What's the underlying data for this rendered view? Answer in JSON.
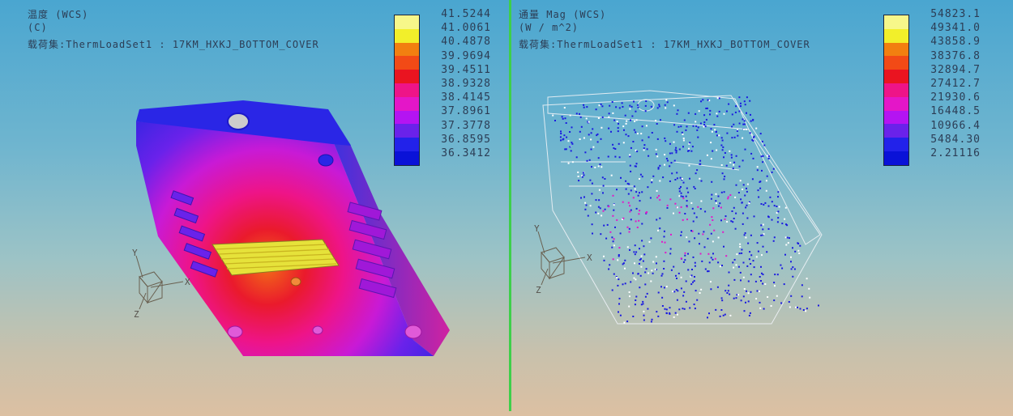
{
  "legend_colors": [
    "#f7f78a",
    "#f2ef2a",
    "#f27f10",
    "#f24a16",
    "#ea1420",
    "#ee1488",
    "#e416c8",
    "#b414f2",
    "#6a22ea",
    "#2222ea",
    "#0a12d8"
  ],
  "left_panel": {
    "header": {
      "line1": "温度 (WCS)",
      "line2": "(C)",
      "line3": "载荷集:ThermLoadSet1 : 17KM_HXKJ_BOTTOM_COVER"
    },
    "legend_values": [
      "41.5244",
      "41.0061",
      "40.4878",
      "39.9694",
      "39.4511",
      "38.9328",
      "38.4145",
      "37.8961",
      "37.3778",
      "36.8595",
      "36.3412"
    ],
    "triad": {
      "x": "X",
      "y": "Y",
      "z": "Z"
    }
  },
  "right_panel": {
    "header": {
      "line1": "通量 Mag (WCS)",
      "line2": "(W / m^2)",
      "line3": "载荷集:ThermLoadSet1 : 17KM_HXKJ_BOTTOM_COVER"
    },
    "legend_values": [
      "54823.1",
      "49341.0",
      "43858.9",
      "38376.8",
      "32894.7",
      "27412.7",
      "21930.6",
      "16448.5",
      "10966.4",
      "5484.30",
      "2.21116"
    ],
    "triad": {
      "x": "X",
      "y": "Y",
      "z": "Z"
    }
  }
}
